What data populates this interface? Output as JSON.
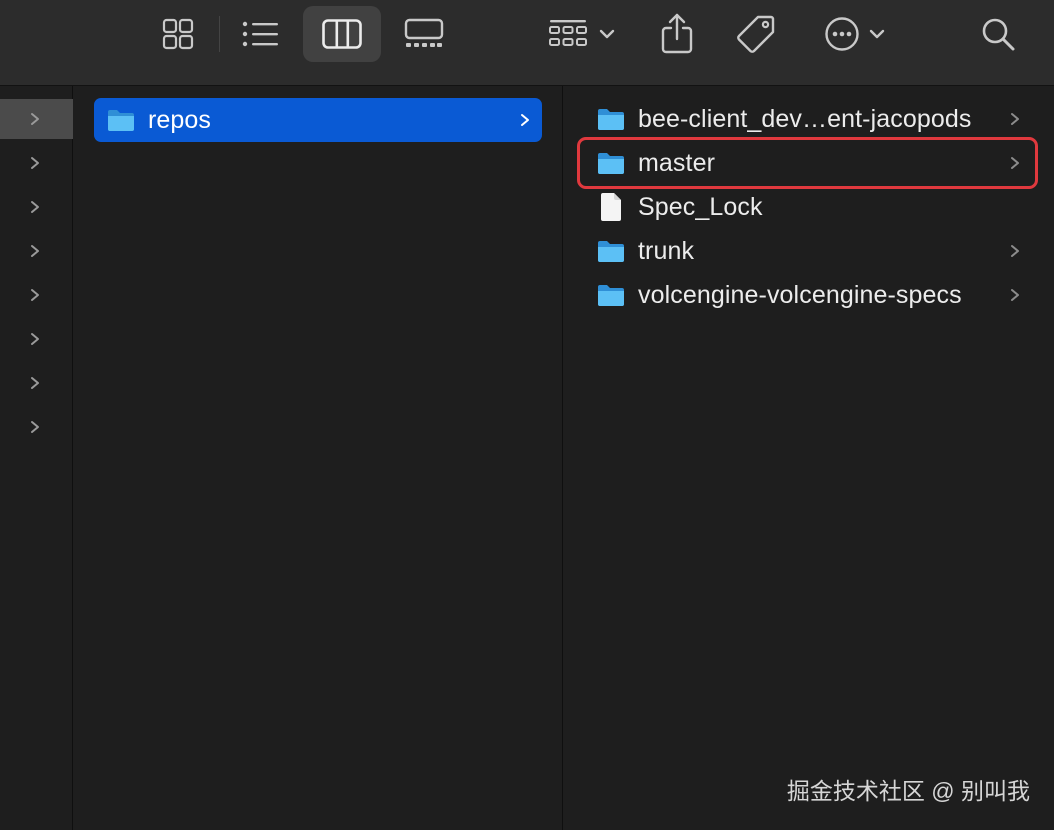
{
  "toolbar": {
    "buttons": [
      {
        "name": "icon-view",
        "icon": "grid-icon"
      },
      {
        "name": "list-view",
        "icon": "list-icon"
      },
      {
        "name": "column-view",
        "icon": "columns-icon",
        "active": true
      },
      {
        "name": "gallery-view",
        "icon": "gallery-icon"
      },
      {
        "name": "group-menu",
        "icon": "group-grid-icon"
      },
      {
        "name": "share",
        "icon": "share-icon"
      },
      {
        "name": "tags",
        "icon": "tag-icon"
      },
      {
        "name": "more-actions",
        "icon": "ellipsis-circle-icon"
      },
      {
        "name": "search",
        "icon": "magnifier-icon"
      }
    ]
  },
  "columns": {
    "parent_column": {
      "rows": 8,
      "selected_index": 0
    },
    "middle": {
      "items": [
        {
          "label": "repos",
          "type": "folder",
          "selected": true,
          "has_children": true
        }
      ]
    },
    "contents": {
      "items": [
        {
          "label": "bee-client_dev…ent-jacopods",
          "type": "folder",
          "has_children": true
        },
        {
          "label": "master",
          "type": "folder",
          "has_children": true,
          "highlighted": true
        },
        {
          "label": "Spec_Lock",
          "type": "file",
          "has_children": false
        },
        {
          "label": "trunk",
          "type": "folder",
          "has_children": true
        },
        {
          "label": "volcengine-volcengine-specs",
          "type": "folder",
          "has_children": true
        }
      ]
    }
  },
  "colors": {
    "selection": "#0a5ad4",
    "highlight_border": "#e0393e",
    "folder": "#3aa8f0",
    "background": "#1e1e1e",
    "toolbar": "#2c2c2c"
  },
  "watermark": "掘金技术社区 @ 别叫我"
}
